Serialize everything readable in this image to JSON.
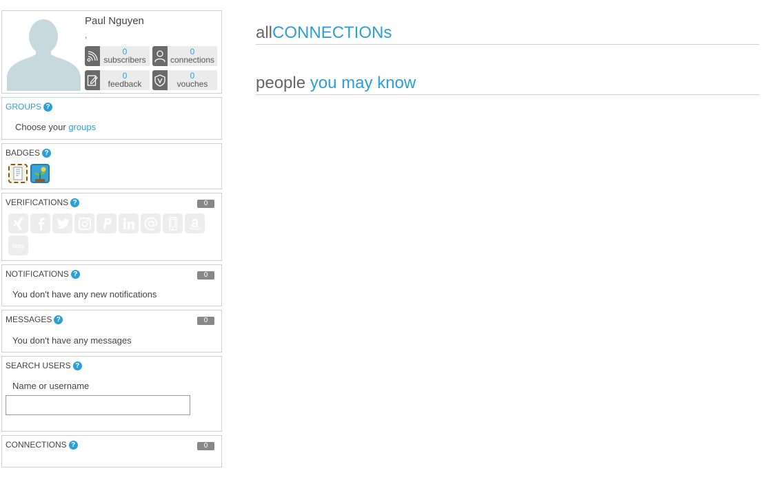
{
  "profile": {
    "name": "Paul Nguyen",
    "subtitle": ",",
    "stats": [
      {
        "count": "0",
        "label": "subscribers",
        "icon": "rss-icon"
      },
      {
        "count": "0",
        "label": "connections",
        "icon": "person-icon"
      },
      {
        "count": "0",
        "label": "feedback",
        "icon": "edit-icon"
      },
      {
        "count": "0",
        "label": "vouches",
        "icon": "shield-v-icon"
      }
    ]
  },
  "groups": {
    "title": "GROUPS",
    "text_prefix": "Choose your ",
    "link": "groups"
  },
  "badges": {
    "title": "BADGES",
    "items": [
      "certificate-badge",
      "sprout-badge"
    ]
  },
  "verifications": {
    "title": "VERIFICATIONS",
    "count": "0",
    "icons": [
      "xing-icon",
      "facebook-icon",
      "twitter-icon",
      "instagram-icon",
      "paypal-icon",
      "linkedin-icon",
      "email-icon",
      "phone-icon",
      "amazon-icon",
      "ebay-icon"
    ],
    "ebay_text": "ebay"
  },
  "notifications": {
    "title": "NOTIFICATIONS",
    "count": "0",
    "text": "You don't have any new notifications"
  },
  "messages": {
    "title": "MESSAGES",
    "count": "0",
    "text": "You don't have any messages"
  },
  "search": {
    "title": "SEARCH USERS",
    "label": "Name or username",
    "value": ""
  },
  "connections": {
    "title": "CONNECTIONS",
    "count": "0"
  },
  "main": {
    "all_prefix": "all",
    "all_main": "CONNECTIONs",
    "people_prefix": "people ",
    "people_main": "you may know"
  },
  "help_glyph": "?",
  "colors": {
    "accent": "#2c9fd6",
    "badge_grey": "#888888",
    "icon_grey": "#6a6a6a"
  }
}
